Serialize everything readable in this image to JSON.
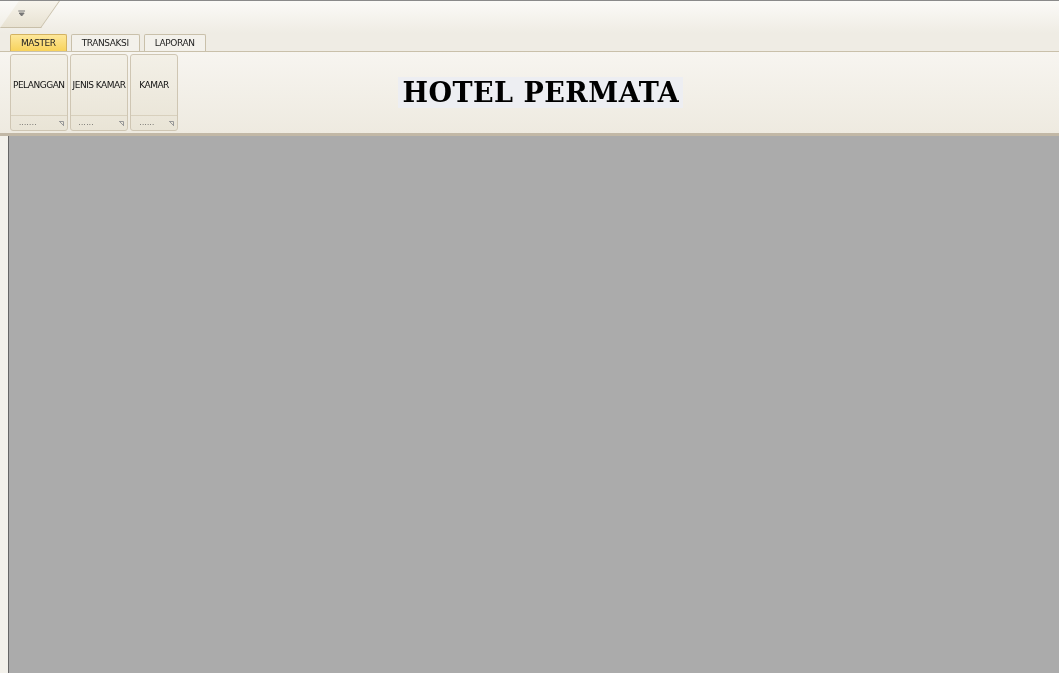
{
  "tabs": [
    {
      "label": "MASTER",
      "selected": true
    },
    {
      "label": "TRANSAKSI",
      "selected": false
    },
    {
      "label": "LAPORAN",
      "selected": false
    }
  ],
  "ribbon_groups": [
    {
      "button": "PELANGGAN",
      "caption": "......."
    },
    {
      "button": "JENIS KAMAR",
      "caption": "......"
    },
    {
      "button": "KAMAR",
      "caption": "......"
    }
  ],
  "banner": "HOTEL PERMATA"
}
